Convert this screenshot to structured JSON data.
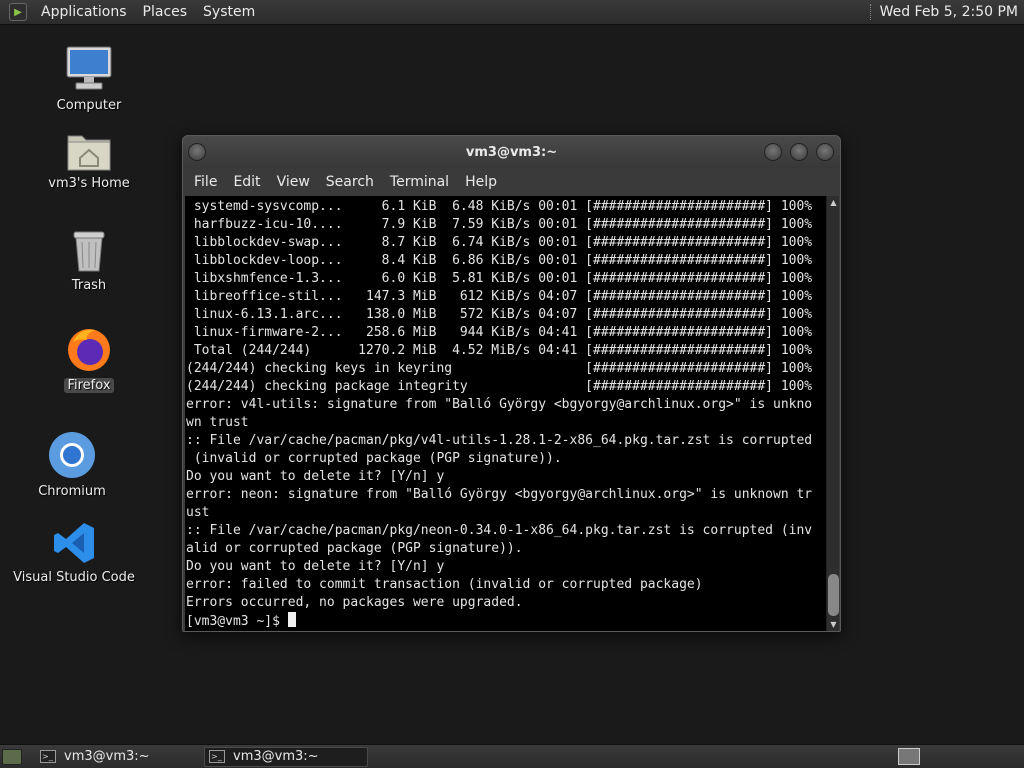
{
  "top_panel": {
    "menu": [
      "Applications",
      "Places",
      "System"
    ],
    "clock": "Wed Feb  5,  2:50 PM"
  },
  "desktop_icons": [
    {
      "name": "computer",
      "label": "Computer"
    },
    {
      "name": "home",
      "label": "vm3's Home"
    },
    {
      "name": "trash",
      "label": "Trash"
    },
    {
      "name": "firefox",
      "label": "Firefox"
    },
    {
      "name": "chromium",
      "label": "Chromium"
    },
    {
      "name": "vscode",
      "label": "Visual Studio Code"
    }
  ],
  "window": {
    "title": "vm3@vm3:~",
    "menu": [
      "File",
      "Edit",
      "View",
      "Search",
      "Terminal",
      "Help"
    ]
  },
  "terminal_lines": [
    " systemd-sysvcomp...     6.1 KiB  6.48 KiB/s 00:01 [######################] 100%",
    " harfbuzz-icu-10....     7.9 KiB  7.59 KiB/s 00:01 [######################] 100%",
    " libblockdev-swap...     8.7 KiB  6.74 KiB/s 00:01 [######################] 100%",
    " libblockdev-loop...     8.4 KiB  6.86 KiB/s 00:01 [######################] 100%",
    " libxshmfence-1.3...     6.0 KiB  5.81 KiB/s 00:01 [######################] 100%",
    " libreoffice-stil...   147.3 MiB   612 KiB/s 04:07 [######################] 100%",
    " linux-6.13.1.arc...   138.0 MiB   572 KiB/s 04:07 [######################] 100%",
    " linux-firmware-2...   258.6 MiB   944 KiB/s 04:41 [######################] 100%",
    " Total (244/244)      1270.2 MiB  4.52 MiB/s 04:41 [######################] 100%",
    "(244/244) checking keys in keyring                 [######################] 100%",
    "(244/244) checking package integrity               [######################] 100%",
    "error: v4l-utils: signature from \"Balló György <bgyorgy@archlinux.org>\" is unkno",
    "wn trust",
    ":: File /var/cache/pacman/pkg/v4l-utils-1.28.1-2-x86_64.pkg.tar.zst is corrupted",
    " (invalid or corrupted package (PGP signature)).",
    "Do you want to delete it? [Y/n] y",
    "error: neon: signature from \"Balló György <bgyorgy@archlinux.org>\" is unknown tr",
    "ust",
    ":: File /var/cache/pacman/pkg/neon-0.34.0-1-x86_64.pkg.tar.zst is corrupted (inv",
    "alid or corrupted package (PGP signature)).",
    "Do you want to delete it? [Y/n] y",
    "error: failed to commit transaction (invalid or corrupted package)",
    "Errors occurred, no packages were upgraded."
  ],
  "prompt": "[vm3@vm3 ~]$ ",
  "taskbar": {
    "tasks": [
      "vm3@vm3:~",
      "vm3@vm3:~"
    ]
  }
}
